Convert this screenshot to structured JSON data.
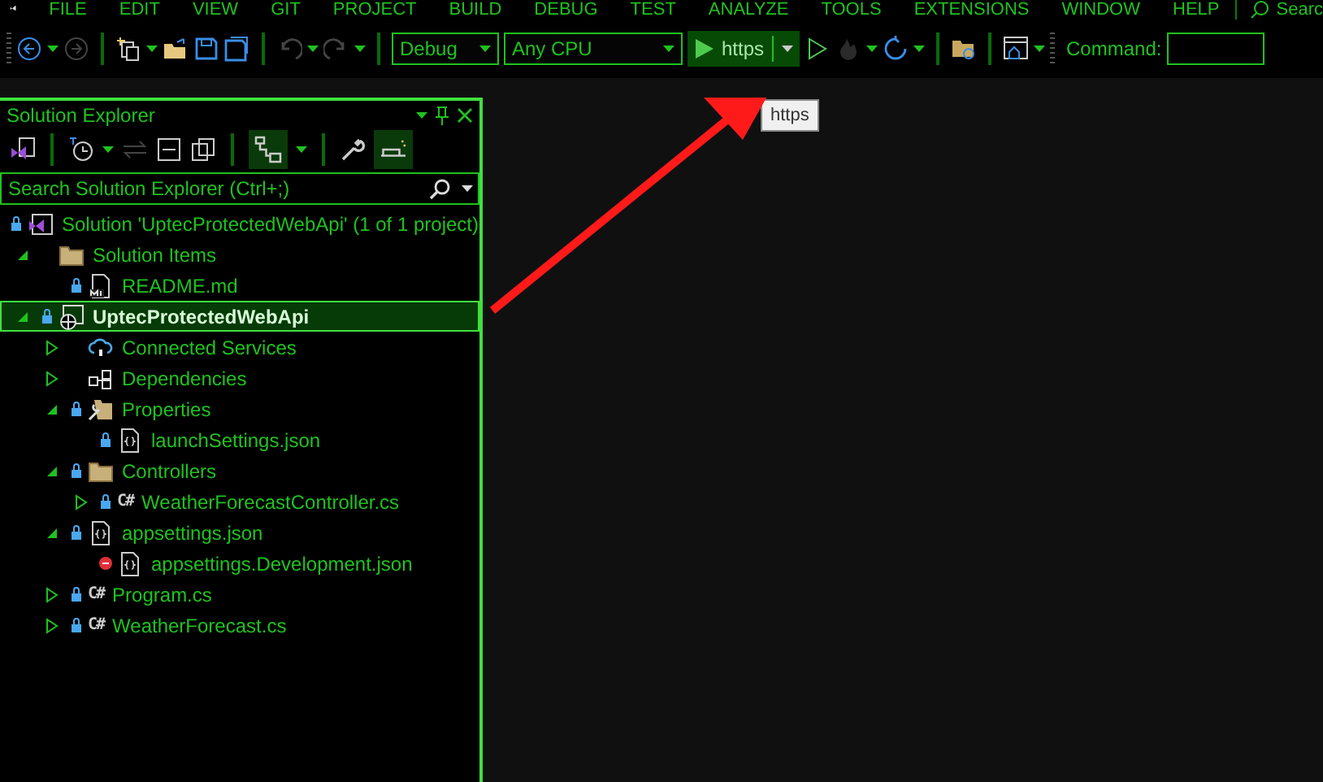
{
  "menu_bar": {
    "items": [
      "FILE",
      "EDIT",
      "VIEW",
      "GIT",
      "PROJECT",
      "BUILD",
      "DEBUG",
      "TEST",
      "ANALYZE",
      "TOOLS",
      "EXTENSIONS",
      "WINDOW",
      "HELP"
    ],
    "search": "Searc"
  },
  "toolbar": {
    "configuration": "Debug",
    "platform": "Any CPU",
    "run_target": "https",
    "command_label": "Command:"
  },
  "tooltip": "https",
  "solution_explorer": {
    "title": "Solution Explorer",
    "search_placeholder": "Search Solution Explorer (Ctrl+;)",
    "tree": [
      {
        "label": "Solution 'UptecProtectedWebApi' (1 of 1 project)",
        "kind": "solution",
        "locked": true,
        "excluded": false,
        "selected": false,
        "children": [
          {
            "label": "Solution Items",
            "kind": "folder",
            "locked": false,
            "excluded": false,
            "expanded": true,
            "selected": false,
            "children": [
              {
                "label": "README.md",
                "kind": "markdown",
                "locked": true,
                "excluded": false,
                "selected": false
              }
            ]
          },
          {
            "label": "UptecProtectedWebApi",
            "kind": "project",
            "locked": true,
            "excluded": false,
            "expanded": true,
            "selected": true,
            "children": [
              {
                "label": "Connected Services",
                "kind": "cloud",
                "locked": false,
                "excluded": false,
                "expanded": false,
                "selected": false
              },
              {
                "label": "Dependencies",
                "kind": "dependencies",
                "locked": false,
                "excluded": false,
                "expanded": false,
                "selected": false
              },
              {
                "label": "Properties",
                "kind": "properties",
                "locked": true,
                "excluded": false,
                "expanded": true,
                "selected": false,
                "children": [
                  {
                    "label": "launchSettings.json",
                    "kind": "json",
                    "locked": true,
                    "excluded": false,
                    "selected": false
                  }
                ]
              },
              {
                "label": "Controllers",
                "kind": "folder",
                "locked": true,
                "excluded": false,
                "expanded": true,
                "selected": false,
                "children": [
                  {
                    "label": "WeatherForecastController.cs",
                    "kind": "csharp",
                    "icon_text": "C#",
                    "locked": true,
                    "excluded": false,
                    "expanded": false,
                    "selected": false
                  }
                ]
              },
              {
                "label": "appsettings.json",
                "kind": "json",
                "locked": true,
                "excluded": false,
                "expanded": true,
                "selected": false,
                "children": [
                  {
                    "label": "appsettings.Development.json",
                    "kind": "json",
                    "locked": false,
                    "excluded": true,
                    "selected": false
                  }
                ]
              },
              {
                "label": "Program.cs",
                "kind": "csharp",
                "icon_text": "C#",
                "locked": true,
                "excluded": false,
                "expanded": false,
                "selected": false
              },
              {
                "label": "WeatherForecast.cs",
                "kind": "csharp",
                "icon_text": "C#",
                "locked": true,
                "excluded": false,
                "expanded": false,
                "selected": false
              }
            ]
          }
        ]
      }
    ]
  }
}
